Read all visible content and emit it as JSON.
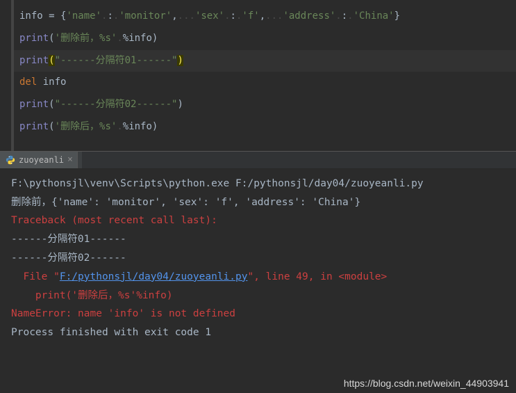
{
  "editor": {
    "line1": {
      "var": "info",
      "eq": " = ",
      "open": "{",
      "k1": "'name'",
      "c1": ":",
      "v1": "'monitor'",
      "s1": ",",
      "k2": "'sex'",
      "c2": ":",
      "v2": "'f'",
      "s2": ",",
      "k3": "'address'",
      "c3": ":",
      "v3": "'China'",
      "close": "}"
    },
    "line2": {
      "fn": "print",
      "p1": "(",
      "str": "'删除前，%s'",
      "pct": "%",
      "arg": "info",
      "p2": ")"
    },
    "line3": {
      "fn": "print",
      "p1": "(",
      "str": "\"------分隔符01------\"",
      "p2": ")"
    },
    "line4": {
      "kw": "del",
      "sp": " ",
      "arg": "info"
    },
    "line5": {
      "fn": "print",
      "p1": "(",
      "str": "\"------分隔符02------\"",
      "p2": ")"
    },
    "line6": {
      "fn": "print",
      "p1": "(",
      "str": "'删除后，%s'",
      "pct": "%",
      "arg": "info",
      "p2": ")"
    }
  },
  "tab": {
    "name": "zuoyeanli",
    "close": "×"
  },
  "console": {
    "l1": "F:\\pythonsjl\\venv\\Scripts\\python.exe F:/pythonsjl/day04/zuoyeanli.py",
    "l2": "删除前，{'name': 'monitor', 'sex': 'f', 'address': 'China'}",
    "l3": "Traceback (most recent call last):",
    "l4": "------分隔符01------",
    "l5": "------分隔符02------",
    "l6a": "  File \"",
    "l6link": "F:/pythonsjl/day04/zuoyeanli.py",
    "l6b": "\", line 49, in <module>",
    "l7": "    print('删除后，%s'%info)",
    "l8": "NameError: name 'info' is not defined",
    "l9": "",
    "l10": "Process finished with exit code 1"
  },
  "watermark": "https://blog.csdn.net/weixin_44903941"
}
